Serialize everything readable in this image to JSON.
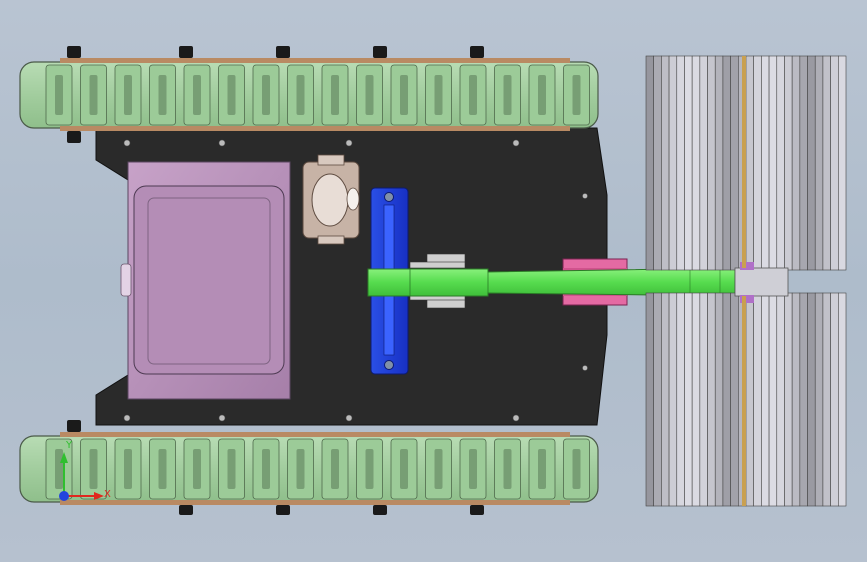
{
  "viewport": {
    "type": "CAD 3D model view (top view)",
    "background_color": "#b4c0ce"
  },
  "model": {
    "parts": [
      {
        "name": "left-track",
        "color": "#a9d3a5"
      },
      {
        "name": "right-track",
        "color": "#a9d3a5"
      },
      {
        "name": "chassis-plate",
        "color": "#2b2b2b"
      },
      {
        "name": "battery-box",
        "color": "#b88fbb"
      },
      {
        "name": "motor-mount",
        "color": "#c9b8aa"
      },
      {
        "name": "blue-bracket",
        "color": "#1f3fd8"
      },
      {
        "name": "green-arm",
        "color": "#5ee35a"
      },
      {
        "name": "pink-coupler",
        "color": "#e05a9a"
      },
      {
        "name": "roller-wheel",
        "color": "#c7c7cf"
      }
    ]
  },
  "triad": {
    "x_label": "X",
    "y_label": "Y",
    "x_color": "#e0281e",
    "y_color": "#2fbf2f",
    "z_color": "#2244dd"
  }
}
